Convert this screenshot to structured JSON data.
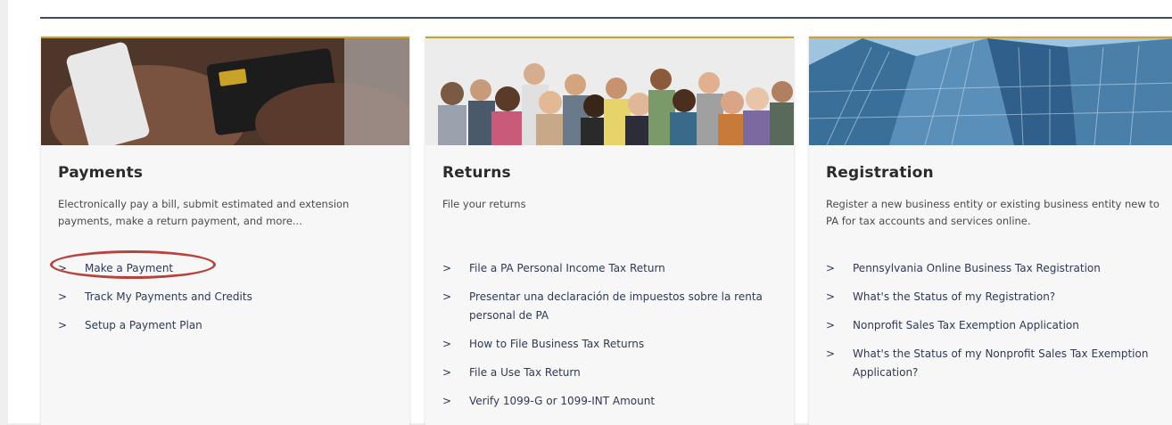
{
  "cards": [
    {
      "title": "Payments",
      "description": "Electronically pay a bill, submit estimated and extension payments, make a return payment, and more...",
      "links": [
        "Make a Payment",
        "Track My Payments and Credits",
        "Setup a Payment Plan"
      ]
    },
    {
      "title": "Returns",
      "description": "File your returns",
      "links": [
        "File a PA Personal Income Tax Return",
        "Presentar una declaración de impuestos sobre la renta personal de PA",
        "How to File Business Tax Returns",
        "File a Use Tax Return",
        "Verify 1099-G or 1099-INT Amount"
      ]
    },
    {
      "title": "Registration",
      "description": "Register a new business entity or existing business entity new to PA for tax accounts and services online.",
      "links": [
        "Pennsylvania Online Business Tax Registration",
        "What's the Status of my Registration?",
        "Nonprofit Sales Tax Exemption Application",
        "What's the Status of my Nonprofit Sales Tax Exemption Application?"
      ]
    }
  ],
  "chevron": ">",
  "colors": {
    "accent_border": "#c9a227",
    "link": "#2d3a55",
    "highlight": "#b5423b",
    "rule": "#3a4a6e"
  }
}
